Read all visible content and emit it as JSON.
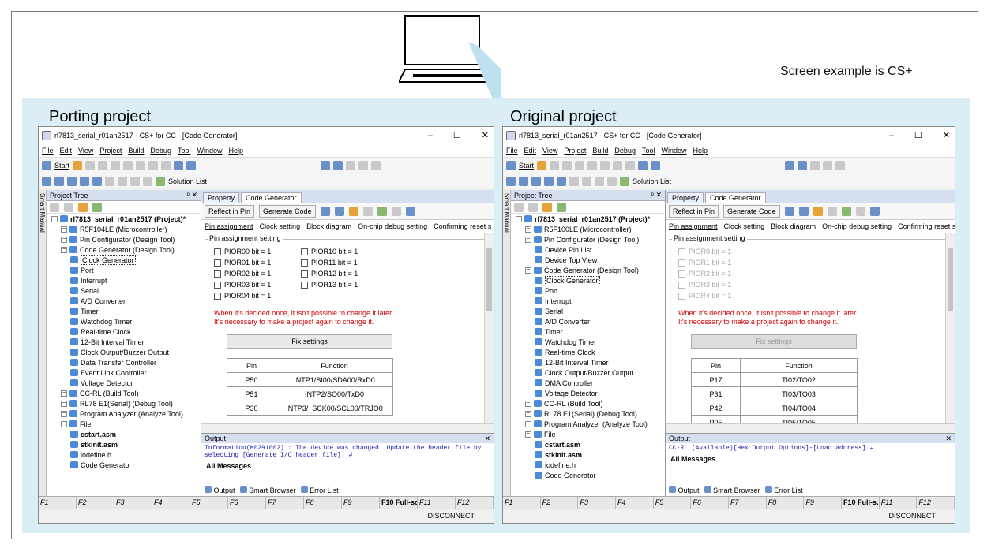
{
  "note": "Screen example is CS+",
  "left": {
    "heading": "Porting project",
    "title": "rl7813_serial_r01an2517 - CS+ for CC - [Code Generator]",
    "tree_nodes": [
      {
        "label": "rl7813_serial_r01an2517 (Project)*",
        "indent": 1,
        "bold": true
      },
      {
        "label": "R5F104LE (Microcontroller)",
        "indent": 2
      },
      {
        "label": "Pin Configurator (Design Tool)",
        "indent": 2
      },
      {
        "label": "Code Generator (Design Tool)",
        "indent": 2
      },
      {
        "label": "Clock Generator",
        "indent": 3,
        "sel": true
      },
      {
        "label": "Port",
        "indent": 3
      },
      {
        "label": "Interrupt",
        "indent": 3
      },
      {
        "label": "Serial",
        "indent": 3
      },
      {
        "label": "A/D Converter",
        "indent": 3
      },
      {
        "label": "Timer",
        "indent": 3
      },
      {
        "label": "Watchdog Timer",
        "indent": 3
      },
      {
        "label": "Real-time Clock",
        "indent": 3
      },
      {
        "label": "12-Bit Interval Timer",
        "indent": 3
      },
      {
        "label": "Clock Output/Buzzer Output",
        "indent": 3
      },
      {
        "label": "Data Transfer Controller",
        "indent": 3
      },
      {
        "label": "Event Link Controller",
        "indent": 3
      },
      {
        "label": "Voltage Detector",
        "indent": 3
      },
      {
        "label": "CC-RL (Build Tool)",
        "indent": 2
      },
      {
        "label": "RL78 E1(Serial) (Debug Tool)",
        "indent": 2
      },
      {
        "label": "Program Analyzer (Analyze Tool)",
        "indent": 2
      },
      {
        "label": "File",
        "indent": 2
      },
      {
        "label": "cstart.asm",
        "indent": 3,
        "bold": true
      },
      {
        "label": "stkinit.asm",
        "indent": 3,
        "bold": true
      },
      {
        "label": "iodefine.h",
        "indent": 3
      },
      {
        "label": "Code Generator",
        "indent": 3
      }
    ],
    "checks": [
      "PIOR00 bit = 1",
      "PIOR10 bit = 1",
      "PIOR01 bit = 1",
      "PIOR11 bit = 1",
      "PIOR02 bit = 1",
      "PIOR12 bit = 1",
      "PIOR03 bit = 1",
      "PIOR13 bit = 1",
      "PIOR04 bit = 1"
    ],
    "checks_disabled": false,
    "rows": [
      [
        "P50",
        "INTP1/SI00/SDA00/RxD0"
      ],
      [
        "P51",
        "INTP2/SO00/TxD0"
      ],
      [
        "P30",
        "INTP3/_SCK00/SCL00/TRJO0"
      ]
    ],
    "output_text": "Information(M0291002) : The device was changed. Update the header file by selecting [Generate I/O header file]. ↲",
    "f10": "F10 Full-sc..."
  },
  "right": {
    "heading": "Original project",
    "title": "rl7813_serial_r01an2517 - CS+ for CC - [Code Generator]",
    "tree_nodes": [
      {
        "label": "rl7813_serial_r01an2517 (Project)*",
        "indent": 1,
        "bold": true
      },
      {
        "label": "R5F100LE (Microcontroller)",
        "indent": 2
      },
      {
        "label": "Pin Configurator (Design Tool)",
        "indent": 2
      },
      {
        "label": "Device Pin List",
        "indent": 3
      },
      {
        "label": "Device Top View",
        "indent": 3
      },
      {
        "label": "Code Generator (Design Tool)",
        "indent": 2
      },
      {
        "label": "Clock Generator",
        "indent": 3,
        "sel": true
      },
      {
        "label": "Port",
        "indent": 3
      },
      {
        "label": "Interrupt",
        "indent": 3
      },
      {
        "label": "Serial",
        "indent": 3
      },
      {
        "label": "A/D Converter",
        "indent": 3
      },
      {
        "label": "Timer",
        "indent": 3
      },
      {
        "label": "Watchdog Timer",
        "indent": 3
      },
      {
        "label": "Real-time Clock",
        "indent": 3
      },
      {
        "label": "12-Bit Interval Timer",
        "indent": 3
      },
      {
        "label": "Clock Output/Buzzer Output",
        "indent": 3
      },
      {
        "label": "DMA Controller",
        "indent": 3
      },
      {
        "label": "Voltage Detector",
        "indent": 3
      },
      {
        "label": "CC-RL (Build Tool)",
        "indent": 2
      },
      {
        "label": "RL78 E1(Serial) (Debug Tool)",
        "indent": 2
      },
      {
        "label": "Program Analyzer (Analyze Tool)",
        "indent": 2
      },
      {
        "label": "File",
        "indent": 2
      },
      {
        "label": "cstart.asm",
        "indent": 3,
        "bold": true
      },
      {
        "label": "stkinit.asm",
        "indent": 3,
        "bold": true
      },
      {
        "label": "iodefine.h",
        "indent": 3
      },
      {
        "label": "Code Generator",
        "indent": 3
      }
    ],
    "checks": [
      "PIOR0 bit = 1",
      "PIOR1 bit = 1",
      "PIOR2 bit = 1",
      "PIOR3 bit = 1",
      "PIOR4 bit = 1"
    ],
    "checks_disabled": true,
    "rows": [
      [
        "P17",
        "TI02/TO02"
      ],
      [
        "P31",
        "TI03/TO03"
      ],
      [
        "P42",
        "TI04/TO04"
      ],
      [
        "P05",
        "TI05/TO05"
      ]
    ],
    "output_text": "CC-RL (Available)[Hex Output Options]-[Load address] ↲",
    "f10": "F10 Full-s..."
  },
  "common": {
    "menu": [
      "File",
      "Edit",
      "View",
      "Project",
      "Build",
      "Debug",
      "Tool",
      "Window",
      "Help"
    ],
    "start": "Start",
    "solution_list": "Solution List",
    "project_tree": "Project Tree",
    "smart_manual": "Smart Manual",
    "tab_property": "Property",
    "tab_codegen": "Code Generator",
    "reflect": "Reflect in Pin",
    "generate": "Generate Code",
    "subtabs": [
      "Pin assignment",
      "Clock setting",
      "Block diagram",
      "On-chip debug setting",
      "Confirming reset s"
    ],
    "group_label": "Pin assignment setting",
    "warn1": "When it's decided once, it isn't possible to change it later.",
    "warn2": "It's necessary to make a project again to change it.",
    "fix": "Fix settings",
    "col_pin": "Pin",
    "col_func": "Function",
    "output": "Output",
    "all_messages": "All Messages",
    "otabs": [
      "Output",
      "Smart Browser",
      "Error List"
    ],
    "fkeys": [
      "F1",
      "F2",
      "F3",
      "F4",
      "F5",
      "F6",
      "F7",
      "F8",
      "F9",
      "F11",
      "F12"
    ],
    "disconnect": "DISCONNECT"
  }
}
